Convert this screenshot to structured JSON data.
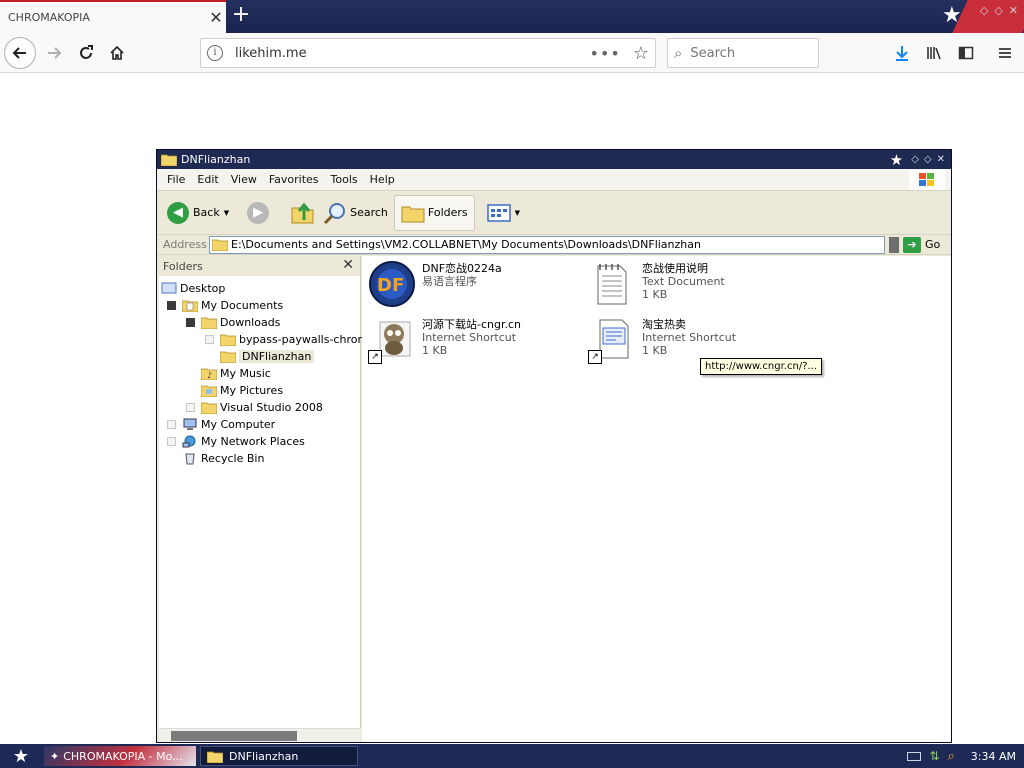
{
  "browser": {
    "tab_title": "CHROMAKOPIA",
    "tab_close": "✕",
    "new_tab": "+",
    "url": "likehim.me",
    "search_placeholder": "Search"
  },
  "window": {
    "title": "DNFlianzhan",
    "menu": [
      "File",
      "Edit",
      "View",
      "Favorites",
      "Tools",
      "Help"
    ],
    "toolbar": {
      "back": "Back",
      "search": "Search",
      "folders": "Folders"
    },
    "address_label": "Address",
    "address_path": "E:\\Documents and Settings\\VM2.COLLABNET\\My Documents\\Downloads\\DNFlianzhan",
    "go": "Go"
  },
  "folders": {
    "header": "Folders",
    "close": "✕",
    "tree": [
      {
        "label": "Desktop"
      },
      {
        "label": "My Documents"
      },
      {
        "label": "Downloads"
      },
      {
        "label": "bypass-paywalls-chrome"
      },
      {
        "label": "DNFlianzhan"
      },
      {
        "label": "My Music"
      },
      {
        "label": "My Pictures"
      },
      {
        "label": "Visual Studio 2008"
      },
      {
        "label": "My Computer"
      },
      {
        "label": "My Network Places"
      },
      {
        "label": "Recycle Bin"
      }
    ]
  },
  "files": [
    {
      "name": "DNF恋战0224a",
      "type": "易语言程序",
      "size": "",
      "icon": "dnf-app-icon"
    },
    {
      "name": "恋战使用说明",
      "type": "Text Document",
      "size": "1 KB",
      "icon": "text-document-icon"
    },
    {
      "name": "河源下载站-cngr.cn",
      "type": "Internet Shortcut",
      "size": "1 KB",
      "icon": "raccoon-shortcut-icon"
    },
    {
      "name": "淘宝热卖",
      "type": "Internet Shortcut",
      "size": "1 KB",
      "icon": "web-shortcut-icon"
    }
  ],
  "tooltip": "http://www.cngr.cn/?...",
  "taskbar": {
    "browser_task": "CHROMAKOPIA - Mo...",
    "explorer_task": "DNFlianzhan",
    "time": "3:34 AM"
  },
  "colors": {
    "browser_tabbar": "#24305e",
    "accent_red": "#c61b25",
    "xp_title": "#1f2a52",
    "firefox_blue": "#0a84ff"
  }
}
